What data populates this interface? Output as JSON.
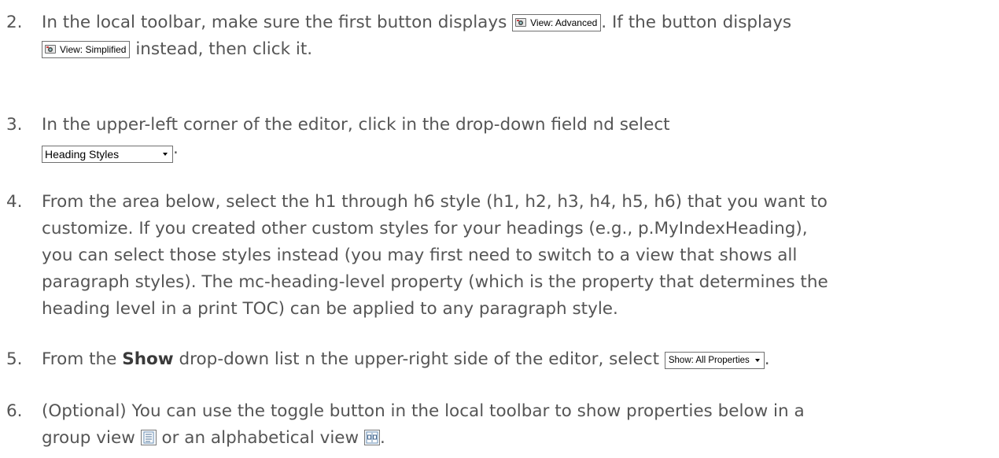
{
  "steps": [
    {
      "num": "2.",
      "l1_a": "In the local toolbar, make sure the first button displays",
      "btn1": "View: Advanced",
      "l1_b": ". If the button displays",
      "btn2": "View: Simplified",
      "l2": " instead, then click it."
    },
    {
      "num": "3.",
      "l1": "In the upper-left corner of the editor, click in the drop-down field  nd select",
      "dropdown": "Heading Styles",
      "after": "."
    },
    {
      "num": "4.",
      "lines": [
        "From the area below, select the h1 through h6 style (h1, h2, h3, h4, h5, h6) that you want to",
        "customize. If you created other custom styles for your headings (e.g., p.MyIndexHeading),",
        "you can select those styles instead (you may first need to switch to a view that shows all",
        "paragraph styles). The mc-heading-level property (which is the property that determines the",
        "heading level in a print TOC) can be applied to any paragraph style."
      ]
    },
    {
      "num": "5.",
      "a": "From the ",
      "bold": "Show",
      "b": " drop-down list  n the upper-right side of the editor, select ",
      "btn": "Show: All Properties",
      "after": "."
    },
    {
      "num": "6.",
      "l1": "(Optional) You can use the toggle button in the local toolbar to show properties below in a",
      "l2_a": "group view ",
      "l2_b": " or an alphabetical view ",
      "after": ".",
      "icons": [
        "group-view-icon",
        "alphabetical-view-icon"
      ]
    }
  ]
}
